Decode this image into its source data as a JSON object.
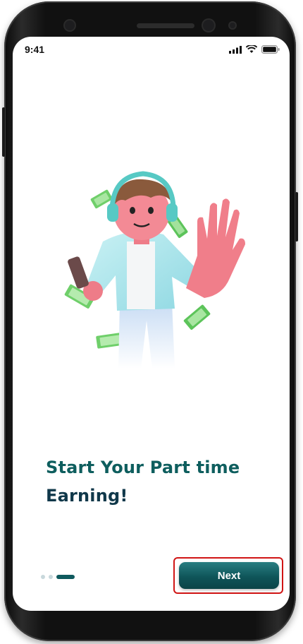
{
  "status_bar": {
    "time": "9:41"
  },
  "onboarding": {
    "title_line1": "Start Your Part time",
    "title_line2": "Earning!",
    "page_count": 3,
    "active_page": 3
  },
  "actions": {
    "next_label": "Next"
  },
  "colors": {
    "brand": "#0f5a5e",
    "title": "#0e5e5e",
    "highlight_outline": "#d01515"
  }
}
